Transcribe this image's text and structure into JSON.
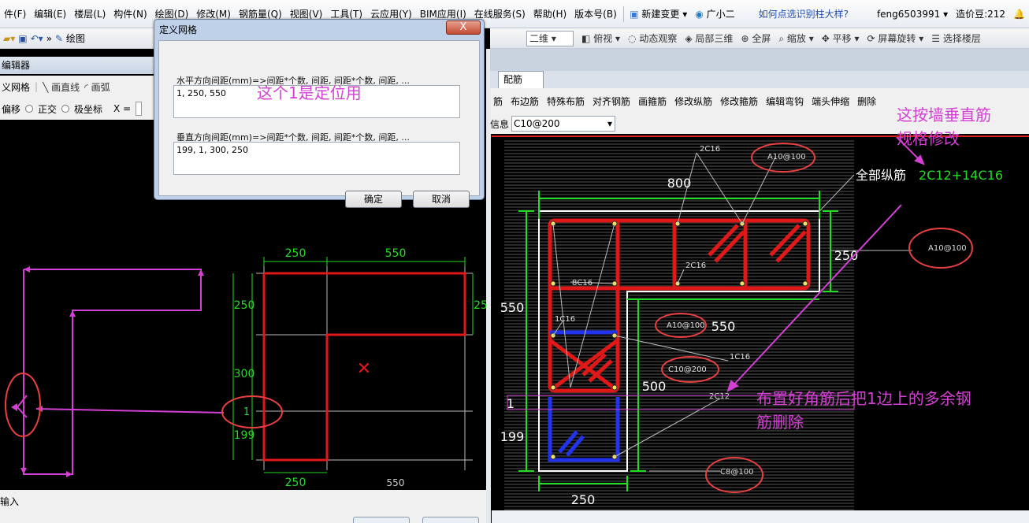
{
  "menubar": {
    "items": [
      "件(F)",
      "编辑(E)",
      "楼层(L)",
      "构件(N)",
      "绘图(D)",
      "修改(M)",
      "钢筋量(Q)",
      "视图(V)",
      "工具(T)",
      "云应用(Y)",
      "BIM应用(I)",
      "在线服务(S)",
      "帮助(H)",
      "版本号(B)"
    ],
    "new_change": "新建变更",
    "assistant": "广小二",
    "help_link": "如何点选识别柱大样?",
    "user": "feng6503991",
    "coins": "造价豆:212"
  },
  "left_panel": {
    "draw_label": "绘图",
    "title": "编辑器",
    "tool_row1": [
      "义网格",
      "画直线",
      "画弧"
    ],
    "tool_row2_offset": "偏移",
    "tool_row2_ortho": "正交",
    "tool_row2_polar": "极坐标",
    "x_label": "X =",
    "bottom_input": "输入"
  },
  "dialog": {
    "title": "定义网格",
    "close": "X",
    "horizontal_label": "水平方向间距(mm)=>间距*个数, 间距, 间距*个数, 间距, ...",
    "horizontal_value": "1, 250, 550",
    "vertical_label": "垂直方向间距(mm)=>间距*个数, 间距, 间距*个数, 间距, ...",
    "vertical_value": "199, 1, 300, 250",
    "ok": "确定",
    "cancel": "取消"
  },
  "annotations": {
    "dialog_note": "这个1是定位用",
    "wall_note": "这按墙垂直筋规格修改",
    "wall_note_1": "这按墙垂直筋",
    "wall_note_2": "规格修改",
    "corner_note_1": "布置好角筋后把1边上的多余钢",
    "corner_note_2": "筋删除"
  },
  "right_panel": {
    "toolbar": [
      "二维",
      "俯视",
      "动态观察",
      "局部三维",
      "全屏",
      "缩放",
      "平移",
      "屏幕旋转",
      "选择楼层"
    ],
    "tab": "配筋",
    "rebar_tools": [
      "筋",
      "布边筋",
      "特殊布筋",
      "对齐钢筋",
      "画箍筋",
      "修改纵筋",
      "修改箍筋",
      "编辑弯钩",
      "端头伸缩",
      "删除"
    ],
    "info_label": "信息",
    "info_value": "C10@200"
  },
  "left_drawing": {
    "top_dims": [
      "250",
      "550"
    ],
    "left_dims": [
      "250",
      "300",
      "1",
      "199"
    ],
    "right_dim": "25",
    "bottom_dims": [
      "250",
      "550"
    ]
  },
  "right_drawing": {
    "dims": {
      "top": "800",
      "right": "250",
      "left": "550",
      "mid": "550",
      "inner": "500",
      "lower_left": "199",
      "one": "1",
      "bottom": "250"
    },
    "labels": {
      "top_bar": "2C16",
      "stirrup_top": "A10@100",
      "stirrup_right": "A10@100",
      "stirrup_mid": "A10@100",
      "tie": "C10@200",
      "side_8": "8C16",
      "side_1": "1C16",
      "mid_2c16": "2C16",
      "side_1c16b": "1C16",
      "two_c12": "2C12",
      "bottom_stirrup": "C8@100"
    },
    "total_label": "全部纵筋",
    "total_value": "2C12+14C16"
  },
  "colors": {
    "accent_magenta": "#d43fd4",
    "dim_green": "#22dd22",
    "wall_red": "#e01818",
    "rebar_blue": "#2233ee"
  }
}
